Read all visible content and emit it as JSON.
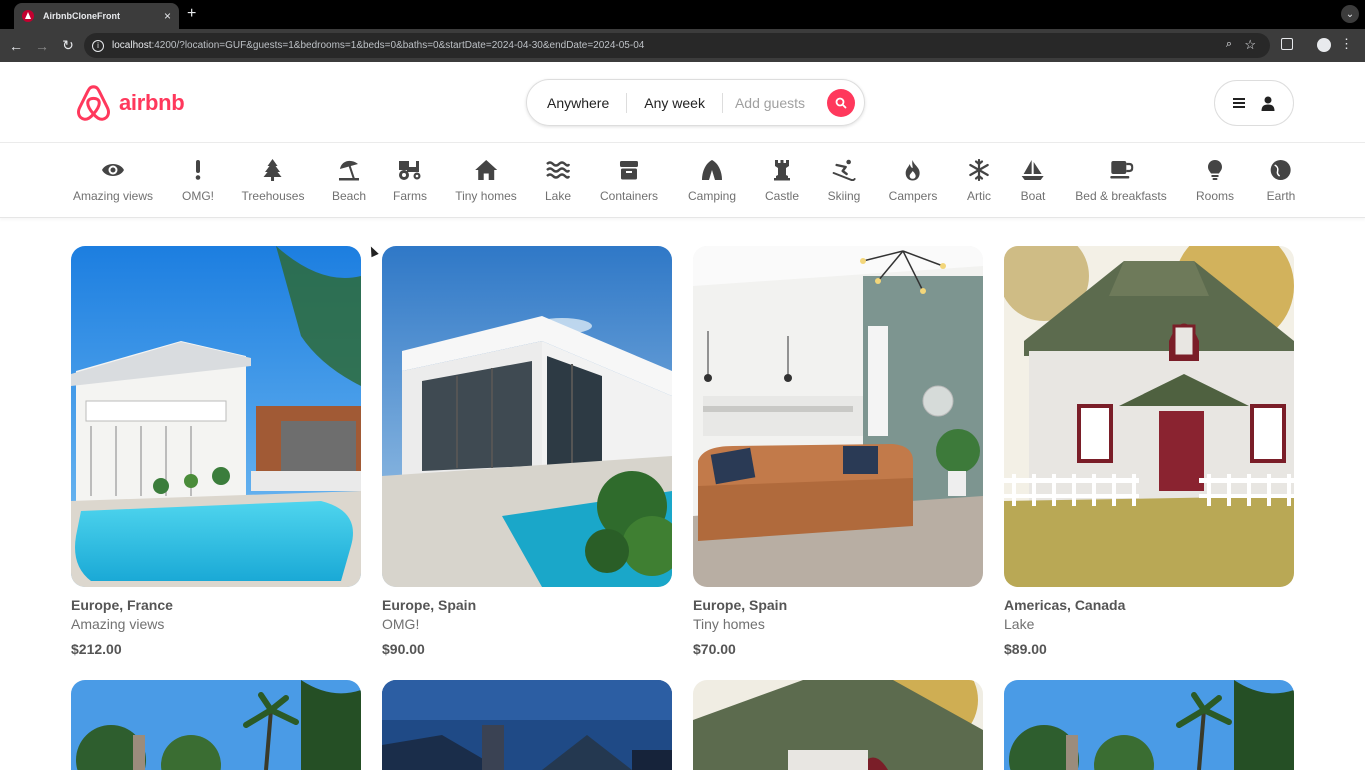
{
  "browser": {
    "tab_title": "AirbnbCloneFront",
    "url_host": "localhost",
    "url_rest": ":4200/?location=GUF&guests=1&bedrooms=1&beds=0&baths=0&startDate=2024-04-30&endDate=2024-05-04",
    "new_tab_label": "+",
    "close_label": "×"
  },
  "brand": {
    "name": "airbnb",
    "color": "#ff385c"
  },
  "search": {
    "where_label": "Anywhere",
    "when_label": "Any week",
    "guests_placeholder": "Add guests"
  },
  "categories": [
    {
      "label": "Amazing views",
      "icon": "eye-icon"
    },
    {
      "label": "OMG!",
      "icon": "exclamation-icon"
    },
    {
      "label": "Treehouses",
      "icon": "tree-icon"
    },
    {
      "label": "Beach",
      "icon": "umbrella-icon"
    },
    {
      "label": "Farms",
      "icon": "tractor-icon"
    },
    {
      "label": "Tiny homes",
      "icon": "house-icon"
    },
    {
      "label": "Lake",
      "icon": "water-icon"
    },
    {
      "label": "Containers",
      "icon": "box-icon"
    },
    {
      "label": "Camping",
      "icon": "tent-icon"
    },
    {
      "label": "Castle",
      "icon": "chess-rook-icon"
    },
    {
      "label": "Skiing",
      "icon": "skier-icon"
    },
    {
      "label": "Campers",
      "icon": "fire-icon"
    },
    {
      "label": "Artic",
      "icon": "snowflake-icon"
    },
    {
      "label": "Boat",
      "icon": "sailboat-icon"
    },
    {
      "label": "Bed & breakfasts",
      "icon": "mug-icon"
    },
    {
      "label": "Rooms",
      "icon": "lightbulb-icon"
    },
    {
      "label": "Earth",
      "icon": "globe-icon"
    }
  ],
  "listings": [
    {
      "location": "Europe, France",
      "type": "Amazing views",
      "price": "$212.00"
    },
    {
      "location": "Europe, Spain",
      "type": "OMG!",
      "price": "$90.00"
    },
    {
      "location": "Europe, Spain",
      "type": "Tiny homes",
      "price": "$70.00"
    },
    {
      "location": "Americas, Canada",
      "type": "Lake",
      "price": "$89.00"
    }
  ]
}
